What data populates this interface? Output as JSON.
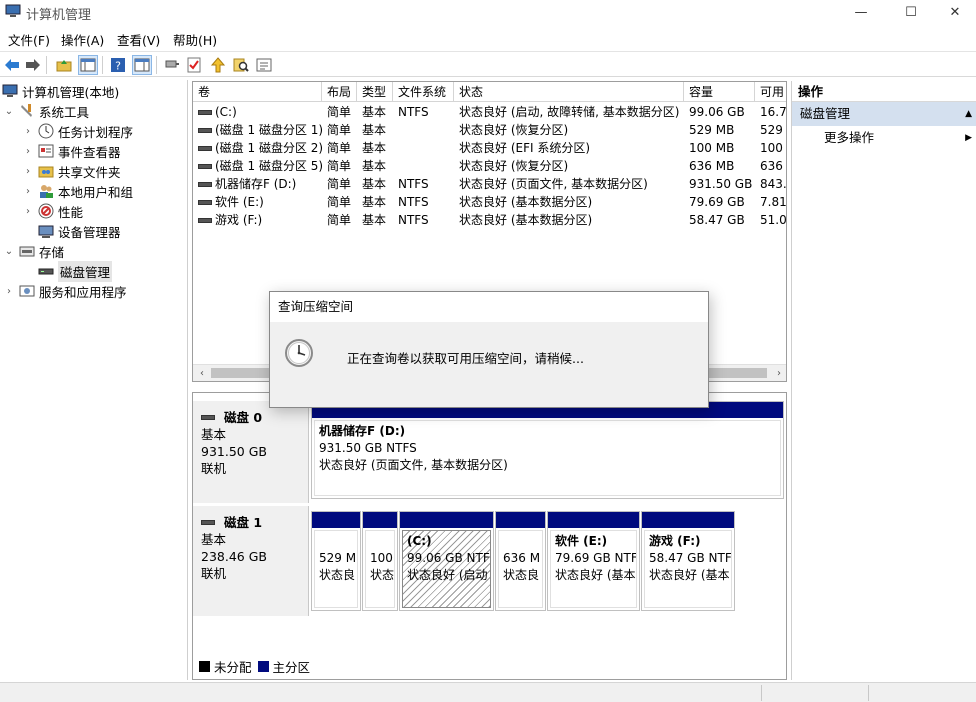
{
  "window": {
    "title": "计算机管理",
    "controls": [
      "—",
      "☐",
      "✕"
    ]
  },
  "menu": [
    "文件(F)",
    "操作(A)",
    "查看(V)",
    "帮助(H)"
  ],
  "tree": {
    "root": "计算机管理(本地)",
    "system_tools": "系统工具",
    "task_scheduler": "任务计划程序",
    "event_viewer": "事件查看器",
    "shared_folders": "共享文件夹",
    "local_users": "本地用户和组",
    "performance": "性能",
    "device_manager": "设备管理器",
    "storage": "存储",
    "disk_management": "磁盘管理",
    "services_apps": "服务和应用程序"
  },
  "volumes": {
    "columns": [
      "卷",
      "布局",
      "类型",
      "文件系统",
      "状态",
      "容量",
      "可用"
    ],
    "rows": [
      [
        "(C:)",
        "简单",
        "基本",
        "NTFS",
        "状态良好 (启动, 故障转储, 基本数据分区)",
        "99.06 GB",
        "16.7"
      ],
      [
        "(磁盘 1 磁盘分区 1)",
        "简单",
        "基本",
        "",
        "状态良好 (恢复分区)",
        "529 MB",
        "529"
      ],
      [
        "(磁盘 1 磁盘分区 2)",
        "简单",
        "基本",
        "",
        "状态良好 (EFI 系统分区)",
        "100 MB",
        "100"
      ],
      [
        "(磁盘 1 磁盘分区 5)",
        "简单",
        "基本",
        "",
        "状态良好 (恢复分区)",
        "636 MB",
        "636"
      ],
      [
        "机器储存F (D:)",
        "简单",
        "基本",
        "NTFS",
        "状态良好 (页面文件, 基本数据分区)",
        "931.50 GB",
        "843."
      ],
      [
        "软件 (E:)",
        "简单",
        "基本",
        "NTFS",
        "状态良好 (基本数据分区)",
        "79.69 GB",
        "7.81"
      ],
      [
        "游戏 (F:)",
        "简单",
        "基本",
        "NTFS",
        "状态良好 (基本数据分区)",
        "58.47 GB",
        "51.0"
      ]
    ]
  },
  "disks": {
    "disk0": {
      "name": "磁盘 0",
      "type": "基本",
      "size": "931.50 GB",
      "status": "联机",
      "partition": {
        "name": "机器储存F  (D:)",
        "line2": "931.50 GB NTFS",
        "line3": "状态良好 (页面文件, 基本数据分区)"
      }
    },
    "disk1": {
      "name": "磁盘 1",
      "type": "基本",
      "size": "238.46 GB",
      "status": "联机",
      "partitions": [
        {
          "name": "",
          "line2": "529 M",
          "line3": "状态良"
        },
        {
          "name": "",
          "line2": "100",
          "line3": "状态"
        },
        {
          "name": "(C:)",
          "line2": "99.06 GB NTF",
          "line3": "状态良好 (启动"
        },
        {
          "name": "",
          "line2": "636 M",
          "line3": "状态良"
        },
        {
          "name": "软件  (E:)",
          "line2": "79.69 GB NTF",
          "line3": "状态良好 (基本"
        },
        {
          "name": "游戏  (F:)",
          "line2": "58.47 GB NTF",
          "line3": "状态良好 (基本"
        }
      ]
    }
  },
  "legend": {
    "unallocated": "未分配",
    "primary": "主分区"
  },
  "actions": {
    "header": "操作",
    "section": "磁盘管理",
    "more": "更多操作"
  },
  "dialog": {
    "title": "查询压缩空间",
    "message": "正在查询卷以获取可用压缩空间，请稍候..."
  },
  "colors": {
    "partition_band": "#000a7e",
    "selection": "#d4e0ef"
  }
}
